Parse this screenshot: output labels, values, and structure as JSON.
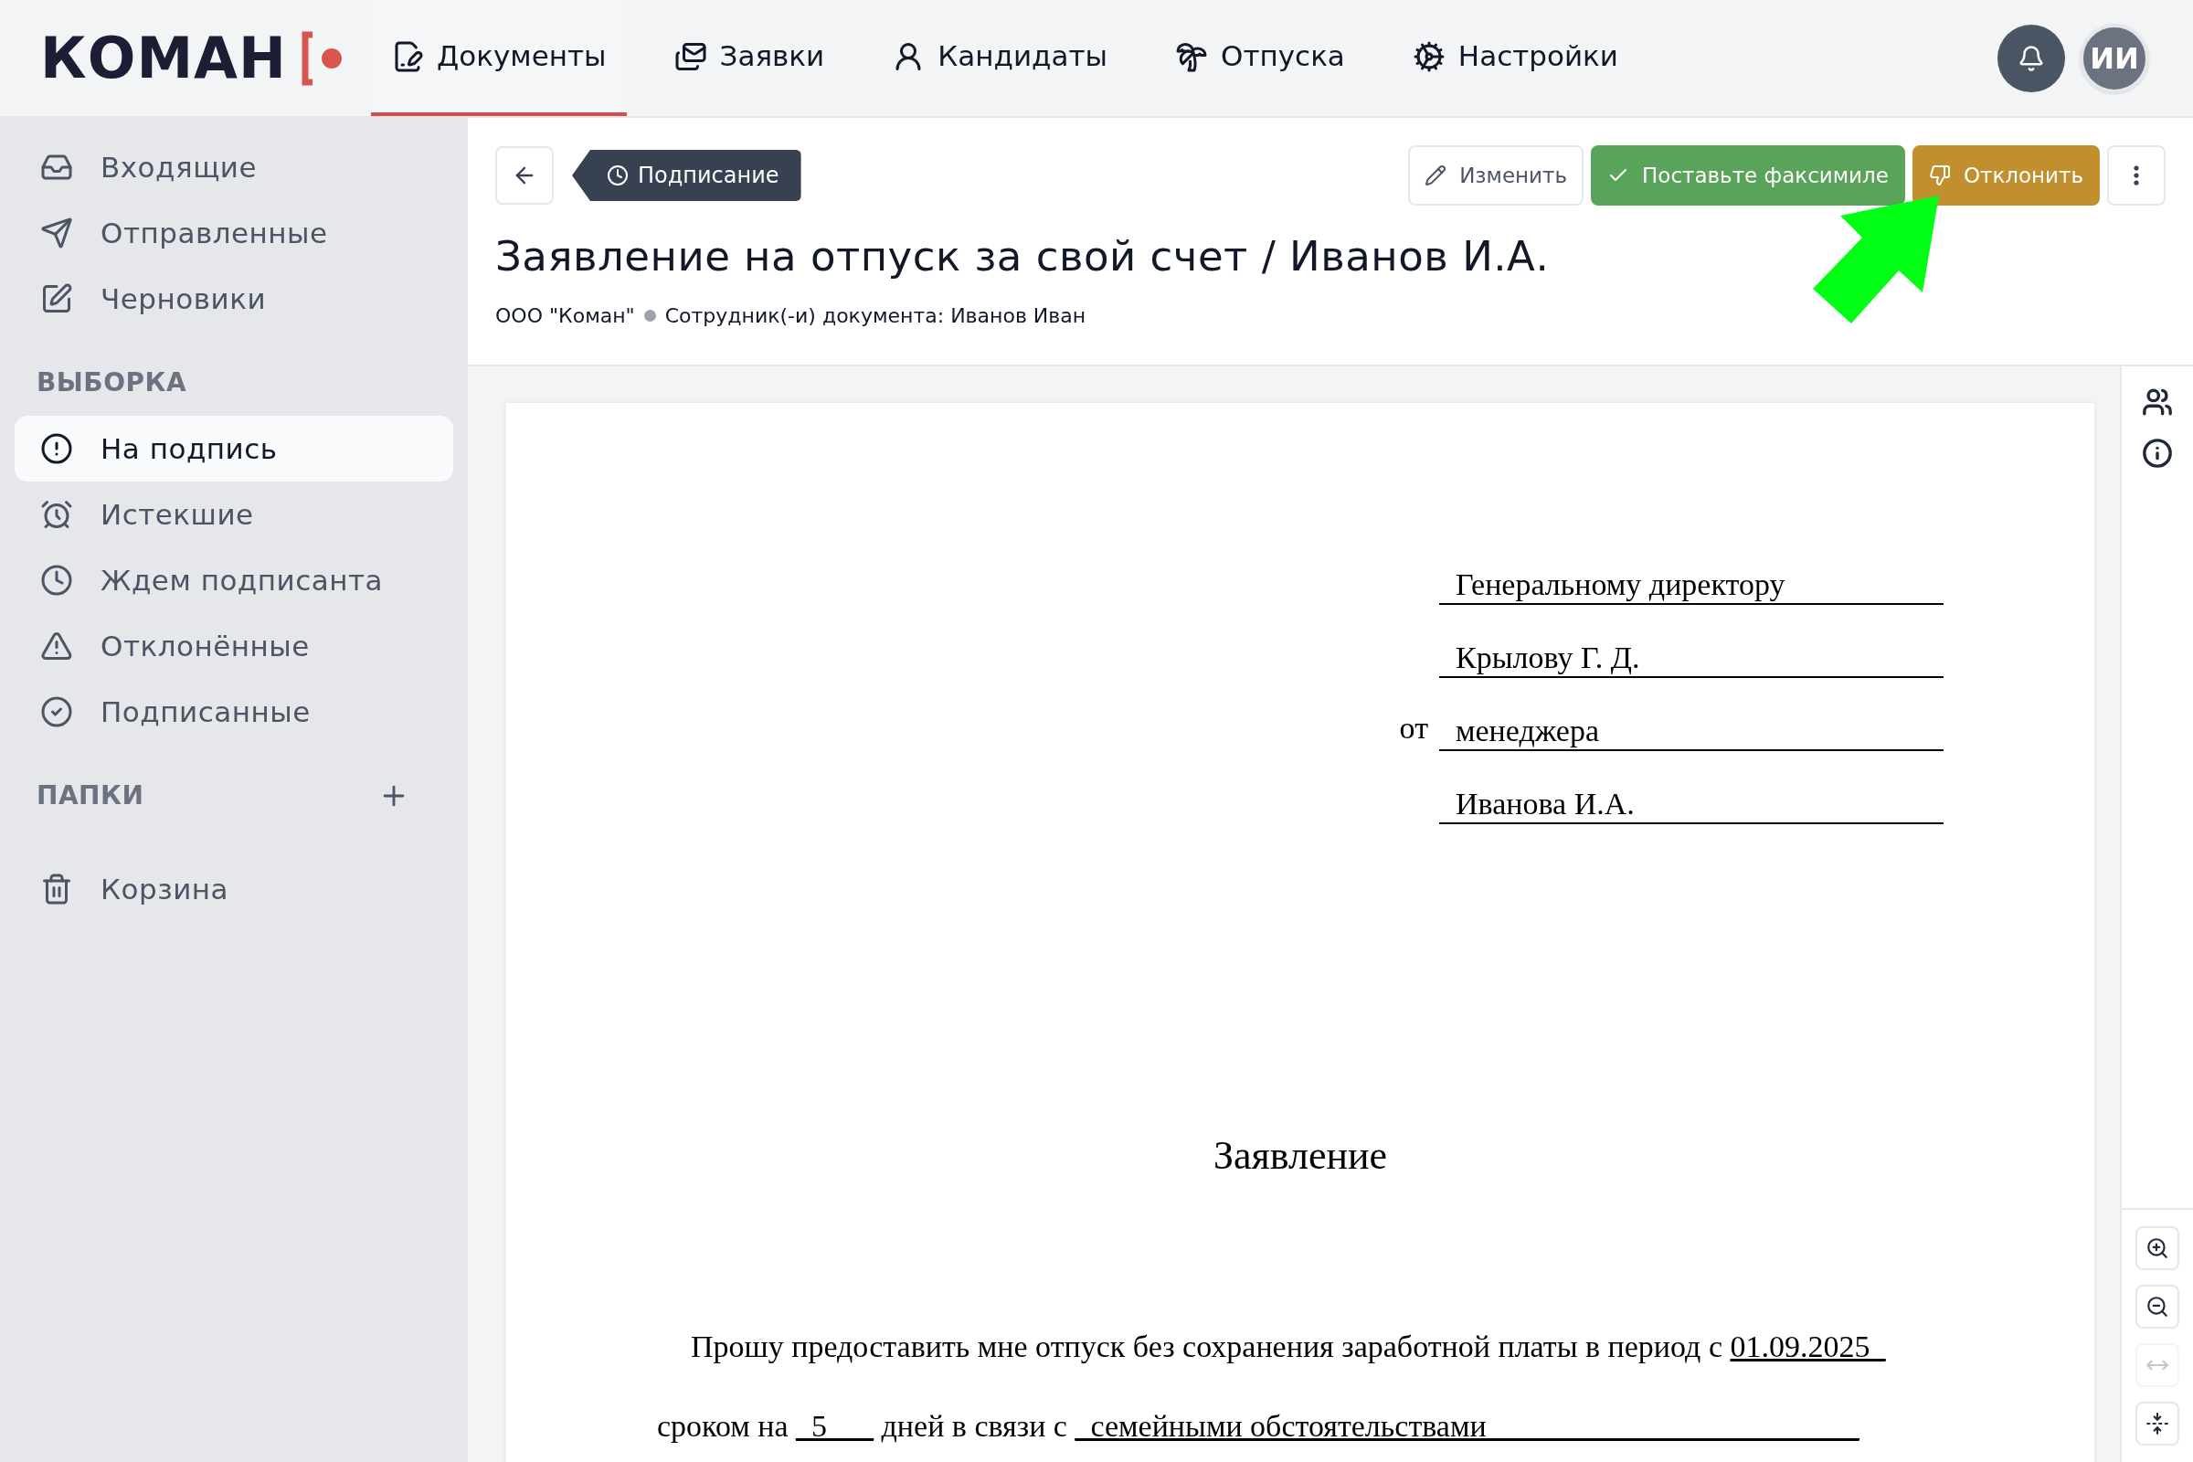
{
  "logo": {
    "text": "КОМАН"
  },
  "nav": [
    {
      "label": "Документы",
      "kind": "documents",
      "selected": true
    },
    {
      "label": "Заявки",
      "kind": "requests",
      "selected": false
    },
    {
      "label": "Кандидаты",
      "kind": "candidates",
      "selected": false
    },
    {
      "label": "Отпуска",
      "kind": "vacations",
      "selected": false
    },
    {
      "label": "Настройки",
      "kind": "settings",
      "selected": false
    }
  ],
  "user": {
    "initials": "ИИ"
  },
  "sidebar": {
    "items": [
      {
        "label": "Входящие",
        "kind": "inbox",
        "selected": false
      },
      {
        "label": "Отправленные",
        "kind": "sent",
        "selected": false
      },
      {
        "label": "Черновики",
        "kind": "drafts",
        "selected": false
      }
    ],
    "sections": [
      {
        "title": "ВЫБОРКА",
        "items": [
          {
            "label": "На подпись",
            "kind": "to-sign",
            "selected": true
          },
          {
            "label": "Истекшие",
            "kind": "expired",
            "selected": false
          },
          {
            "label": "Ждем подписанта",
            "kind": "waiting",
            "selected": false
          },
          {
            "label": "Отклонённые",
            "kind": "rejected",
            "selected": false
          },
          {
            "label": "Подписанные",
            "kind": "signed",
            "selected": false
          }
        ]
      },
      {
        "title": "ПАПКИ",
        "add": true
      }
    ],
    "trash": {
      "label": "Корзина"
    }
  },
  "document": {
    "status": "Подписание",
    "title": "Заявление на отпуск за свой счет / Иванов И.А.",
    "organization": "ООО \"Коман\"",
    "employees": "Сотрудник(-и) документа: Иванов Иван",
    "actions": [
      {
        "label": "Изменить",
        "kind": "edit"
      },
      {
        "label": "Поставьте факсимиле",
        "kind": "sign"
      },
      {
        "label": "Отклонить",
        "kind": "reject"
      }
    ]
  },
  "side_tools": [
    {
      "kind": "participants"
    },
    {
      "kind": "info"
    }
  ],
  "zoom_tools": [
    {
      "kind": "zoom-in",
      "disabled": false
    },
    {
      "kind": "zoom-out",
      "disabled": false
    },
    {
      "kind": "fit-width",
      "disabled": true
    },
    {
      "kind": "fit-height",
      "disabled": false
    }
  ],
  "page": {
    "address": [
      {
        "text": "Генеральному директору"
      },
      {
        "text": "Крылову Г. Д."
      },
      {
        "prefix": "от",
        "text": "менеджера"
      },
      {
        "text": "Иванова И.А."
      }
    ],
    "heading": "Заявление",
    "body": [
      [
        {
          "text": "Прошу предоставить мне отпуск без сохранения заработной платы в период с ",
          "underlined": false
        },
        {
          "text": "01.09.2025_",
          "underlined": true
        }
      ],
      [
        {
          "text": "сроком на ",
          "underlined": false
        },
        {
          "text": "_5___",
          "underlined": true
        },
        {
          "text": " дней в связи с ",
          "underlined": false
        },
        {
          "text": "_семейными обстоятельствами________________________",
          "underlined": true
        }
      ]
    ]
  }
}
